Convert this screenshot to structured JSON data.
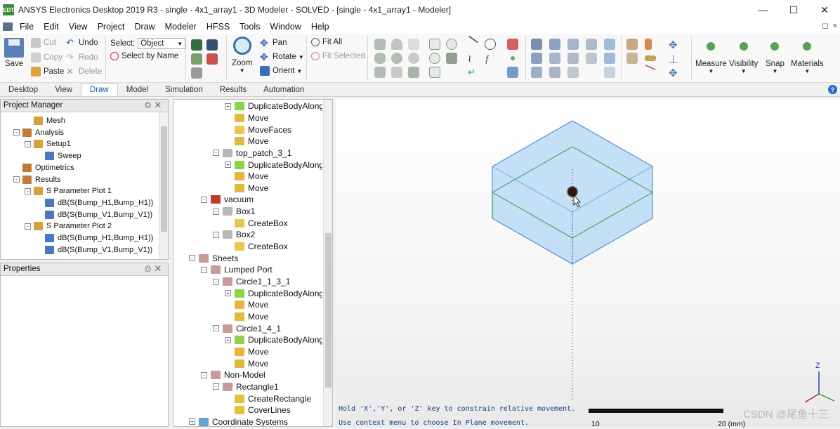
{
  "window": {
    "title": "ANSYS Electronics Desktop 2019 R3 - single - 4x1_array1 - 3D Modeler - SOLVED - [single - 4x1_array1 - Modeler]",
    "app_icon": "EDT"
  },
  "menu": [
    "File",
    "Edit",
    "View",
    "Project",
    "Draw",
    "Modeler",
    "HFSS",
    "Tools",
    "Window",
    "Help"
  ],
  "ribbon": {
    "save": "Save",
    "cut": "Cut",
    "copy": "Copy",
    "paste": "Paste",
    "undo": "Undo",
    "redo": "Redo",
    "delete": "Delete",
    "select_label": "Select:",
    "select_value": "Object",
    "select_by_name": "Select by Name",
    "zoom": "Zoom",
    "pan": "Pan",
    "rotate": "Rotate",
    "orient": "Orient",
    "fit_all": "Fit All",
    "fit_selected": "Fit Selected",
    "measure": "Measure",
    "visibility": "Visibility",
    "snap": "Snap",
    "materials": "Materials"
  },
  "tabs": [
    "Desktop",
    "View",
    "Draw",
    "Model",
    "Simulation",
    "Results",
    "Automation"
  ],
  "active_tab": "Draw",
  "project_manager": {
    "title": "Project Manager",
    "items": [
      {
        "label": "Mesh",
        "level": 3
      },
      {
        "label": "Analysis",
        "level": 2,
        "toggle": "-"
      },
      {
        "label": "Setup1",
        "level": 3,
        "toggle": "-"
      },
      {
        "label": "Sweep",
        "level": 4
      },
      {
        "label": "Optimetrics",
        "level": 2
      },
      {
        "label": "Results",
        "level": 2,
        "toggle": "-"
      },
      {
        "label": "S Parameter Plot 1",
        "level": 3,
        "toggle": "-"
      },
      {
        "label": "dB(S(Bump_H1,Bump_H1))",
        "level": 4
      },
      {
        "label": "dB(S(Bump_V1,Bump_V1))",
        "level": 4
      },
      {
        "label": "S Parameter Plot 2",
        "level": 3,
        "toggle": "-"
      },
      {
        "label": "dB(S(Bump_H1,Bump_H1))",
        "level": 4
      },
      {
        "label": "dB(S(Bump_V1,Bump_V1))",
        "level": 4
      }
    ]
  },
  "properties": {
    "title": "Properties"
  },
  "model_tree": [
    {
      "label": "DuplicateBodyAlong",
      "level": 3,
      "toggle": "+",
      "icon": "dup"
    },
    {
      "label": "Move",
      "level": 3,
      "icon": "move"
    },
    {
      "label": "MoveFaces",
      "level": 3,
      "icon": "cube"
    },
    {
      "label": "Move",
      "level": 3,
      "icon": "move"
    },
    {
      "label": "top_patch_3_1",
      "level": 2,
      "toggle": "-",
      "icon": "obj"
    },
    {
      "label": "DuplicateBodyAlong",
      "level": 3,
      "toggle": "+",
      "icon": "dup"
    },
    {
      "label": "Move",
      "level": 3,
      "icon": "move"
    },
    {
      "label": "Move",
      "level": 3,
      "icon": "move"
    },
    {
      "label": "vacuum",
      "level": 1,
      "toggle": "-",
      "icon": "mat"
    },
    {
      "label": "Box1",
      "level": 2,
      "toggle": "-",
      "icon": "obj"
    },
    {
      "label": "CreateBox",
      "level": 3,
      "icon": "cube"
    },
    {
      "label": "Box2",
      "level": 2,
      "toggle": "-",
      "icon": "obj"
    },
    {
      "label": "CreateBox",
      "level": 3,
      "icon": "cube"
    },
    {
      "label": "Sheets",
      "level": 0,
      "toggle": "-",
      "icon": "sheet"
    },
    {
      "label": "Lumped Port",
      "level": 1,
      "toggle": "-",
      "icon": "sheet"
    },
    {
      "label": "Circle1_1_3_1",
      "level": 2,
      "toggle": "-",
      "icon": "sheet"
    },
    {
      "label": "DuplicateBodyAlong",
      "level": 3,
      "toggle": "+",
      "icon": "dup"
    },
    {
      "label": "Move",
      "level": 3,
      "icon": "move"
    },
    {
      "label": "Move",
      "level": 3,
      "icon": "move"
    },
    {
      "label": "Circle1_4_1",
      "level": 2,
      "toggle": "-",
      "icon": "sheet"
    },
    {
      "label": "DuplicateBodyAlong",
      "level": 3,
      "toggle": "+",
      "icon": "dup"
    },
    {
      "label": "Move",
      "level": 3,
      "icon": "move"
    },
    {
      "label": "Move",
      "level": 3,
      "icon": "move"
    },
    {
      "label": "Non-Model",
      "level": 1,
      "toggle": "-",
      "icon": "sheet"
    },
    {
      "label": "Rectangle1",
      "level": 2,
      "toggle": "-",
      "icon": "sheet"
    },
    {
      "label": "CreateRectangle",
      "level": 3,
      "icon": "rect"
    },
    {
      "label": "CoverLines",
      "level": 3,
      "icon": "rect"
    },
    {
      "label": "Coordinate Systems",
      "level": 0,
      "toggle": "+",
      "icon": "cs"
    }
  ],
  "viewport": {
    "status_line1": "Hold 'X','Y', or 'Z' key to constrain relative movement.",
    "status_line2": "Use context menu to choose In Plane movement.",
    "ruler": [
      "10",
      "20 (mm)"
    ],
    "axis_label": "Z"
  },
  "watermark": "CSDN @尾鱼十三",
  "colors": {
    "box_fill": "#b9daf5",
    "box_edge": "#5a8fd0",
    "inner_line": "#2f9e3c",
    "accent": "#1a5fb4"
  }
}
